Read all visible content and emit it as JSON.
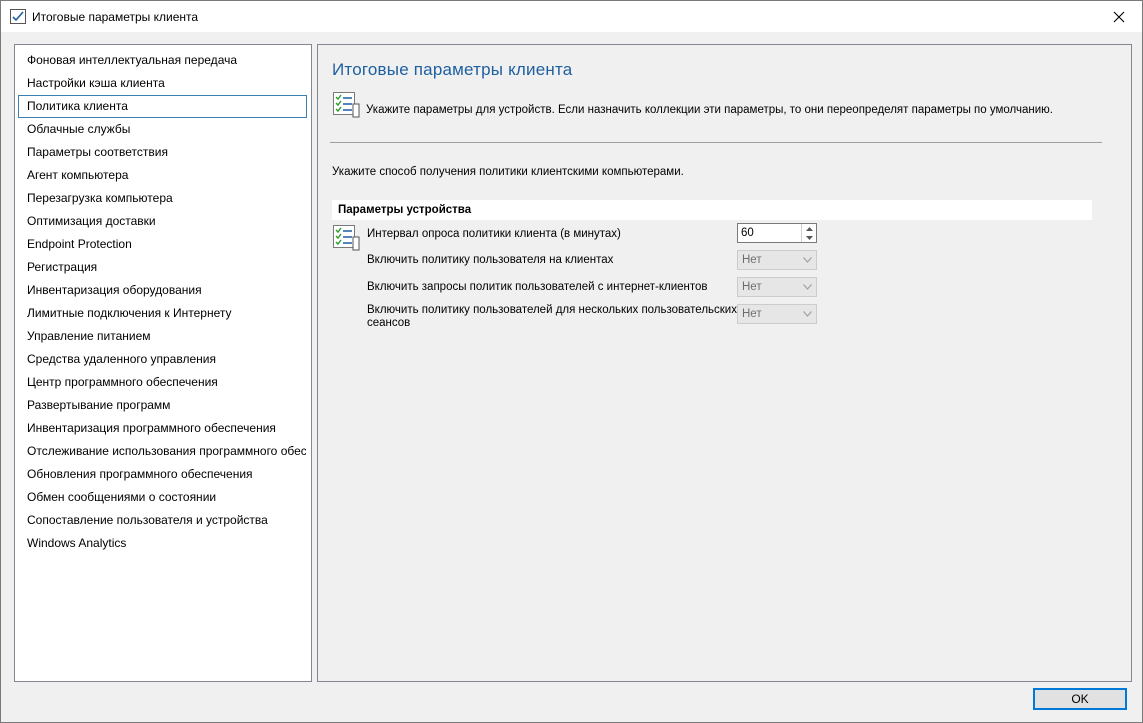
{
  "window": {
    "title": "Итоговые параметры клиента",
    "close_icon": "close-icon",
    "title_icon": "checklist-icon"
  },
  "nav": {
    "selected_index": 2,
    "items": [
      "Фоновая интеллектуальная передача",
      "Настройки кэша клиента",
      "Политика клиента",
      "Облачные службы",
      "Параметры соответствия",
      "Агент компьютера",
      "Перезагрузка компьютера",
      "Оптимизация доставки",
      "Endpoint Protection",
      "Регистрация",
      "Инвентаризация оборудования",
      "Лимитные подключения к Интернету",
      "Управление питанием",
      "Средства удаленного управления",
      "Центр программного обеспечения",
      "Развертывание программ",
      "Инвентаризация программного обеспечения",
      "Отслеживание использования программного обеспечения",
      "Обновления программного обеспечения",
      "Обмен сообщениями о состоянии",
      "Сопоставление пользователя и устройства",
      "Windows Analytics"
    ]
  },
  "content": {
    "title": "Итоговые параметры клиента",
    "intro": "Укажите параметры для устройств. Если назначить коллекции эти параметры, то они переопределят параметры по умолчанию.",
    "instruction": "Укажите способ получения политики клиентскими компьютерами.",
    "group_header": "Параметры устройства",
    "settings": [
      {
        "label": "Интервал опроса политики клиента (в минутах)",
        "value": "60",
        "control": "spin"
      },
      {
        "label": "Включить политику пользователя на клиентах",
        "value": "Нет",
        "control": "combo"
      },
      {
        "label": "Включить запросы политик пользователей с интернет-клиентов",
        "value": "Нет",
        "control": "combo"
      },
      {
        "label": "Включить политику пользователей для нескольких пользовательских сеансов",
        "value": "Нет",
        "control": "combo"
      }
    ]
  },
  "footer": {
    "ok_label": "OK"
  },
  "colors": {
    "accent_title": "#1e5fa0",
    "selection_border": "#3c7fb1",
    "default_button_border": "#0078d7"
  }
}
